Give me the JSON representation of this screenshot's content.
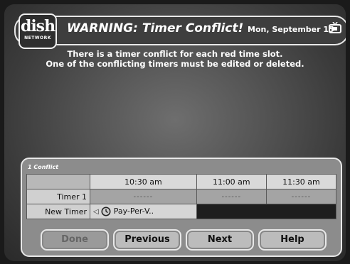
{
  "header": {
    "logo_main": "dish",
    "logo_sub": "NETWORK",
    "title": "WARNING: Timer Conflict!",
    "date": "Mon, September 15",
    "icon": "tv-icon"
  },
  "message": {
    "line1": "There is a timer conflict for each red time slot.",
    "line2": "One of the conflicting timers must be edited or deleted."
  },
  "panel": {
    "conflict_label": "1 Conflict",
    "times": [
      "10:30 am",
      "11:00 am",
      "11:30 am"
    ],
    "rows": [
      {
        "label": "Timer 1",
        "slots": [
          "------",
          "------",
          "------"
        ]
      },
      {
        "label": "New Timer",
        "arrow": "◁",
        "program": "Pay-Per-V.."
      }
    ]
  },
  "buttons": {
    "done": "Done",
    "previous": "Previous",
    "next": "Next",
    "help": "Help"
  }
}
